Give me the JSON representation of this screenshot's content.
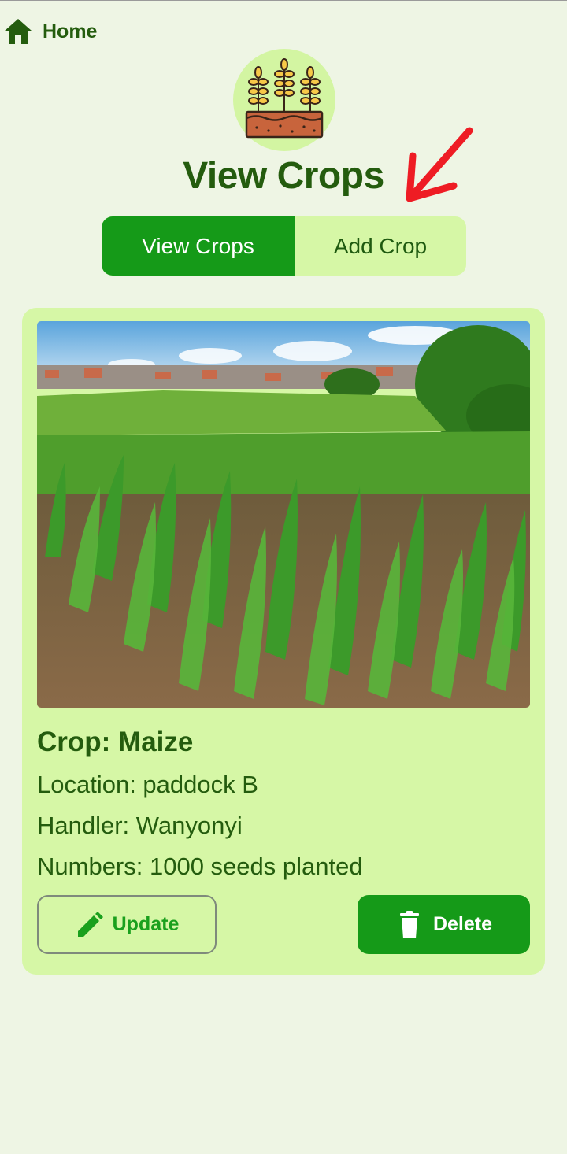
{
  "nav": {
    "home_label": "Home",
    "home_icon": "home-icon"
  },
  "header": {
    "logo_icon": "wheat-crops-icon",
    "title": "View Crops"
  },
  "annotation": {
    "arrow_icon": "red-arrow-icon",
    "color": "#ee1c24"
  },
  "tabs": [
    {
      "label": "View Crops",
      "active": true
    },
    {
      "label": "Add Crop",
      "active": false
    }
  ],
  "crop_card": {
    "image_icon": "maize-field-photo",
    "crop": "Crop: Maize",
    "location": "Location: paddock B",
    "handler": "Handler: Wanyonyi",
    "numbers": "Numbers: 1000 seeds planted",
    "update_label": "Update",
    "update_icon": "pencil-icon",
    "delete_label": "Delete",
    "delete_icon": "trash-icon"
  },
  "colors": {
    "background": "#eef5e4",
    "accent": "#159a18",
    "card": "#d6f7a6",
    "text": "#245c0e"
  }
}
